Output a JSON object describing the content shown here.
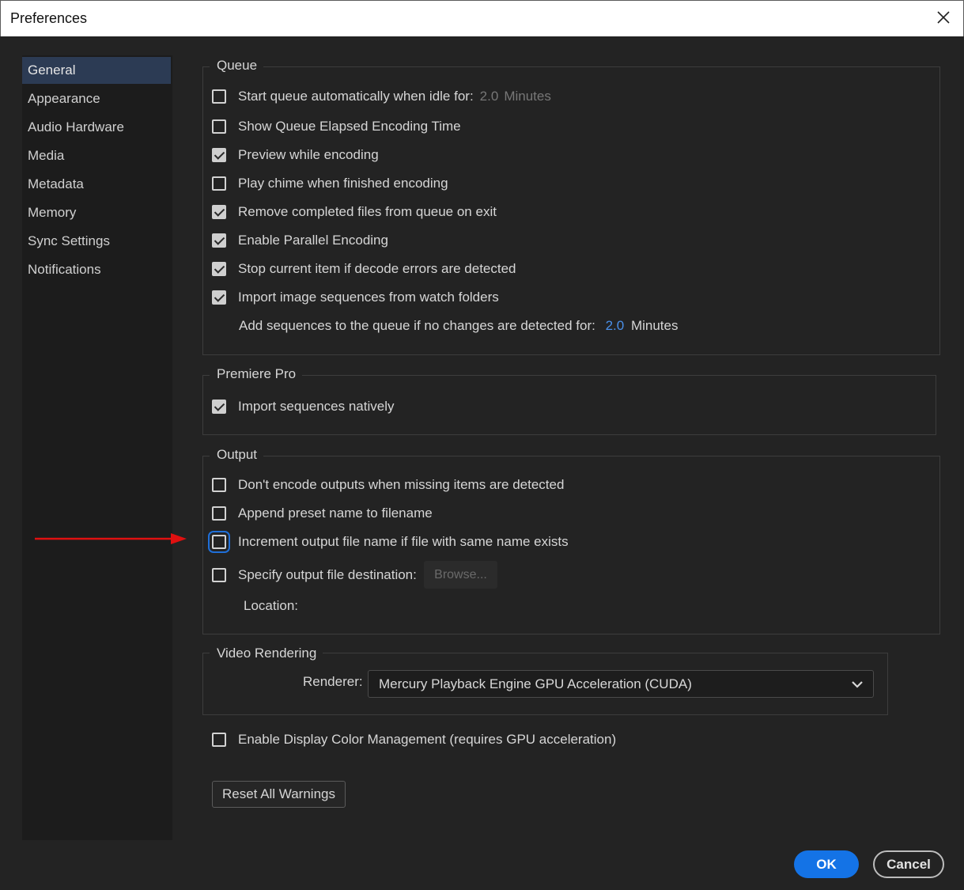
{
  "window": {
    "title": "Preferences"
  },
  "sidebar": {
    "items": [
      {
        "label": "General",
        "selected": true
      },
      {
        "label": "Appearance",
        "selected": false
      },
      {
        "label": "Audio Hardware",
        "selected": false
      },
      {
        "label": "Media",
        "selected": false
      },
      {
        "label": "Metadata",
        "selected": false
      },
      {
        "label": "Memory",
        "selected": false
      },
      {
        "label": "Sync Settings",
        "selected": false
      },
      {
        "label": "Notifications",
        "selected": false
      }
    ]
  },
  "queue": {
    "legend": "Queue",
    "start_auto": {
      "label": "Start queue automatically when idle for:",
      "value": "2.0",
      "unit": "Minutes",
      "checked": false
    },
    "show_elapsed": {
      "label": "Show Queue Elapsed Encoding Time",
      "checked": false
    },
    "preview": {
      "label": "Preview while encoding",
      "checked": true
    },
    "chime": {
      "label": "Play chime when finished encoding",
      "checked": false
    },
    "remove_completed": {
      "label": "Remove completed files from queue on exit",
      "checked": true
    },
    "parallel": {
      "label": "Enable Parallel Encoding",
      "checked": true
    },
    "stop_decode": {
      "label": "Stop current item if decode errors are detected",
      "checked": true
    },
    "import_watch": {
      "label": "Import image sequences from watch folders",
      "checked": true
    },
    "add_sequences": {
      "label": "Add sequences to the queue if no changes are detected for:",
      "value": "2.0",
      "unit": "Minutes"
    }
  },
  "premiere": {
    "legend": "Premiere Pro",
    "import_native": {
      "label": "Import sequences natively",
      "checked": true
    }
  },
  "output": {
    "legend": "Output",
    "dont_encode": {
      "label": "Don't encode outputs when missing items are detected",
      "checked": false
    },
    "append_preset": {
      "label": "Append preset name to filename",
      "checked": false
    },
    "increment": {
      "label": "Increment output file name if file with same name exists",
      "checked": false
    },
    "specify_dest": {
      "label": "Specify output file destination:",
      "checked": false
    },
    "browse_label": "Browse...",
    "location_label": "Location:"
  },
  "video_rendering": {
    "legend": "Video Rendering",
    "renderer_label": "Renderer:",
    "renderer_value": "Mercury Playback Engine GPU Acceleration (CUDA)"
  },
  "color_mgmt": {
    "label": "Enable Display Color Management (requires GPU acceleration)",
    "checked": false
  },
  "buttons": {
    "reset": "Reset All Warnings",
    "ok": "OK",
    "cancel": "Cancel"
  },
  "colors": {
    "accent": "#1473e6",
    "selection": "#2c3b54",
    "annotation_arrow": "#e01010"
  }
}
